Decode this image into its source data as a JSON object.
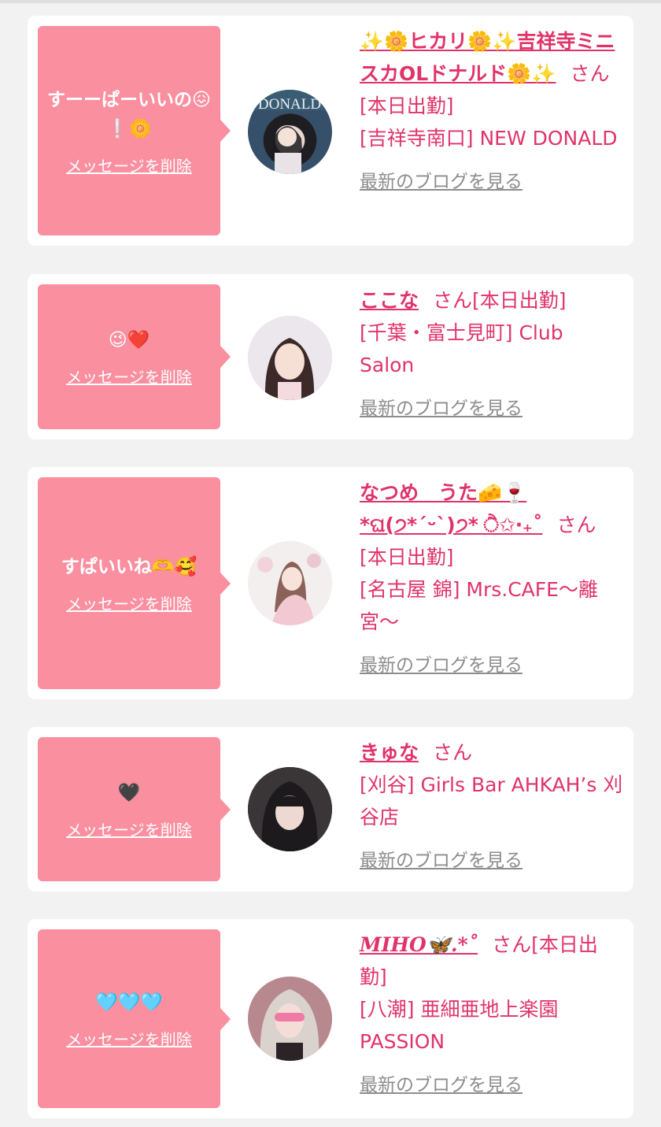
{
  "cards": [
    {
      "message": "すーーぱーいいの😖❕🌼",
      "delete_label": "メッセージを削除",
      "name": "✨🌼ヒカリ🌼✨吉祥寺ミニスカOLドナルド🌼✨",
      "suffix": "さん[本日出勤]",
      "store": "[吉祥寺南口] NEW DONALD",
      "blog_label": "最新のブログを見る",
      "avatar_sign": "DONALD"
    },
    {
      "message": "😉❤️",
      "delete_label": "メッセージを削除",
      "name": "ここな",
      "suffix": "さん[本日出勤]",
      "store": "[千葉・富士見町] Club Salon",
      "blog_label": "最新のブログを見る"
    },
    {
      "message": "すぱいいね🫶🥰",
      "delete_label": "メッセージを削除",
      "name": "なつめ　うた🧀🍷*ଘ(੭*ˊᵕˋ)੭* ੈ✩‧₊˚",
      "suffix": "さん[本日出勤]",
      "store": "[名古屋 錦] Mrs.CAFE〜離宮〜",
      "blog_label": "最新のブログを見る"
    },
    {
      "message": "🖤",
      "delete_label": "メッセージを削除",
      "name": "きゅな",
      "suffix": "さん",
      "store": "[刈谷] Girls Bar AHKAH’s 刈谷店",
      "blog_label": "最新のブログを見る"
    },
    {
      "message": "🩵🩵🩵",
      "delete_label": "メッセージを削除",
      "name": "MIHO🦋.*˚",
      "suffix": "さん[本日出勤]",
      "store": "[八潮] 亜細亜地上楽園PASSION",
      "blog_label": "最新のブログを見る"
    }
  ]
}
